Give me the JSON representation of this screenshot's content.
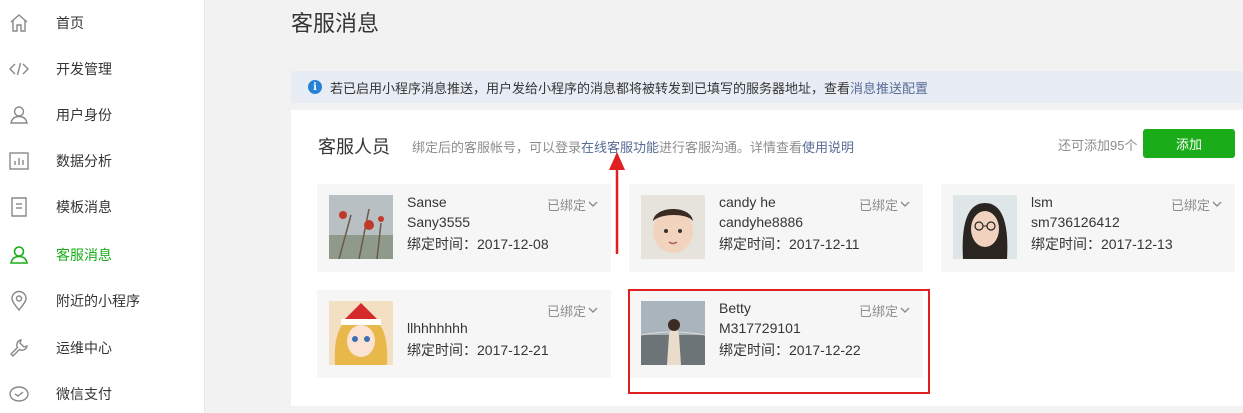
{
  "sidebar": {
    "items": [
      {
        "label": "首页",
        "icon": "home-icon",
        "active": false
      },
      {
        "label": "开发管理",
        "icon": "code-icon",
        "active": false
      },
      {
        "label": "用户身份",
        "icon": "user-icon",
        "active": false
      },
      {
        "label": "数据分析",
        "icon": "bar-chart-icon",
        "active": false
      },
      {
        "label": "模板消息",
        "icon": "document-icon",
        "active": false
      },
      {
        "label": "客服消息",
        "icon": "user-icon",
        "active": true
      },
      {
        "label": "附近的小程序",
        "icon": "location-pin-icon",
        "active": false
      },
      {
        "label": "运维中心",
        "icon": "wrench-icon",
        "active": false
      },
      {
        "label": "微信支付",
        "icon": "wechat-pay-icon",
        "active": false
      }
    ]
  },
  "colors": {
    "accent": "#1aad19",
    "link": "#576b95",
    "highlight": "#e02020",
    "arrow": "#e02020"
  },
  "main": {
    "title": "客服消息",
    "notice": {
      "text": "若已启用小程序消息推送，用户发给小程序的消息都将被转发到已填写的服务器地址，查看",
      "link": "消息推送配置"
    }
  },
  "panel": {
    "title": "客服人员",
    "desc_before": "绑定后的客服帐号，可以登录",
    "desc_link1": "在线客服功能",
    "desc_middle": "进行客服沟通。详情查看",
    "desc_link2": "使用说明",
    "quota": "还可添加95个",
    "add_label": "添加"
  },
  "cards": [
    {
      "name": "Sanse",
      "account": "Sany3555",
      "bind_time": "绑定时间：2017-12-08",
      "status": "已绑定"
    },
    {
      "name": "candy he",
      "account": "candyhe8886",
      "bind_time": "绑定时间：2017-12-11",
      "status": "已绑定"
    },
    {
      "name": "lsm",
      "account": "sm736126412",
      "bind_time": "绑定时间：2017-12-13",
      "status": "已绑定"
    },
    {
      "name": "",
      "account": "llhhhhhhh",
      "bind_time": "绑定时间：2017-12-21",
      "status": "已绑定"
    },
    {
      "name": "Betty",
      "account": "M317729101",
      "bind_time": "绑定时间：2017-12-22",
      "status": "已绑定"
    }
  ]
}
